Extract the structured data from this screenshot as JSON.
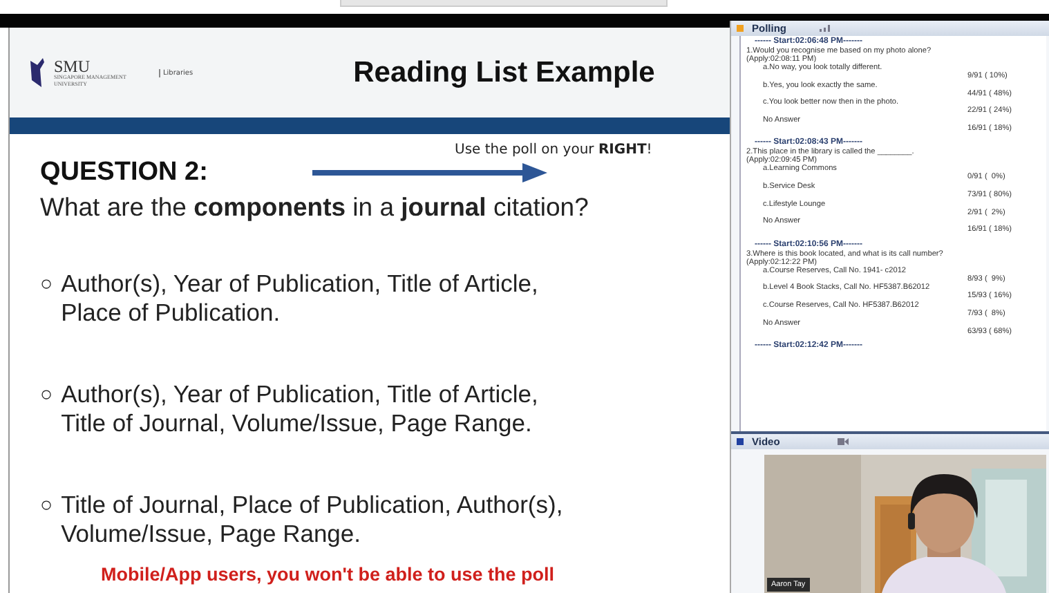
{
  "slide": {
    "logo": {
      "name": "SMU",
      "subtitle": "SINGAPORE MANAGEMENT UNIVERSITY",
      "unit": "Libraries"
    },
    "title": "Reading List Example",
    "hint": "Use the poll on your **RIGHT**!",
    "question_label": "QUESTION 2:",
    "question": "What are the **components** in a **journal** citation?",
    "options": [
      {
        "marker": "○",
        "lines": [
          "Author(s), Year of Publication, Title of Article,",
          "Place of Publication."
        ]
      },
      {
        "marker": "○",
        "lines": [
          "Author(s), Year of Publication, Title of Article,",
          "Title of Journal, Volume/Issue, Page Range."
        ]
      },
      {
        "marker": "○",
        "lines": [
          "Title of Journal, Place of Publication, Author(s),",
          "Volume/Issue, Page Range."
        ]
      }
    ],
    "warning": "Mobile/App users, you won't be able to use the poll"
  },
  "polling": {
    "title": "Polling",
    "polls": [
      {
        "start": "------ Start:02:06:48 PM-------",
        "question": "1.Would you recognise me based on my photo alone?",
        "apply": "(Apply:02:08:11 PM)",
        "answers": [
          {
            "label": "a.No way, you look totally different.",
            "count": "9/91 ( 10%)"
          },
          {
            "label": "b.Yes, you look exactly the same.",
            "count": "44/91 ( 48%)"
          },
          {
            "label": "c.You look better now then in the photo.",
            "count": "22/91 ( 24%)"
          },
          {
            "label": "No Answer",
            "count": "16/91 ( 18%)"
          }
        ]
      },
      {
        "start": "------ Start:02:08:43 PM-------",
        "question": "2.This place in the library is called the ________.",
        "apply": "(Apply:02:09:45 PM)",
        "answers": [
          {
            "label": "a.Learning Commons",
            "count": "0/91 (  0%)"
          },
          {
            "label": "b.Service Desk",
            "count": "73/91 ( 80%)"
          },
          {
            "label": "c.Lifestyle Lounge",
            "count": "2/91 (  2%)"
          },
          {
            "label": "No Answer",
            "count": "16/91 ( 18%)"
          }
        ]
      },
      {
        "start": "------ Start:02:10:56 PM-------",
        "question": "3.Where is this book located, and what is its call number?",
        "apply": "(Apply:02:12:22 PM)",
        "answers": [
          {
            "label": "a.Course Reserves, Call No. 1941- c2012",
            "count": "8/93 (  9%)"
          },
          {
            "label": "b.Level 4 Book Stacks, Call No. HF5387.B62012",
            "count": "15/93 ( 16%)"
          },
          {
            "label": "c.Course Reserves, Call No. HF5387.B62012",
            "count": "7/93 (  8%)"
          },
          {
            "label": "No Answer",
            "count": "63/93 ( 68%)"
          }
        ]
      }
    ],
    "last_start": "------ Start:02:12:42 PM-------"
  },
  "video": {
    "title": "Video",
    "caption": "Aaron Tay"
  }
}
